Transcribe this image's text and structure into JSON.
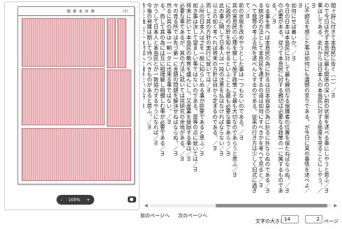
{
  "scan": {
    "header_title": "聞 新 本 日 寿",
    "page_number": "（7）"
  },
  "zoom": {
    "minus": "-",
    "value": "100%",
    "plus": "+"
  },
  "text": {
    "columns": [
      "聞ヶ辞に付きて本島民に告ぐ（一）／m",
      "ので今日は先ず本島民に最も関係の深い前の状景を述べる事にしやうと思ふ／m",
      "事はしてある。此れからは日本人の本島民に対する態度を見ることにしやう。／m",
      "に不調法を感じた事は如何にも遺憾の至りである。が今日に其の事情を述べよ／m",
      "如何にせば善いか。／m",
      "今日の日本は本島民に対して最も親切なる保護者の位置を保たねばならぬ。／m",
      "の必要がある。従つて本島民に対する親切は必要なる政策の一に属するものである。／m",
      "なる事を思へば本島民の為に計るは日本自身の為に計るに外ならぬのである／m",
      "る統治の方法として本島民を遇するの道は如何にすべきかを考へて見ると／m",
      "へて我等の考ふる所を述べんとするのである。従来の行き方は少しく旧式に過ぎて／m",
      "前の状態を改めやうとした事は一つもないのである。／m",
      "其の実島民の心理を察して施す政策こそ最も大切なのであらうと思ふ／m",
      "に政府の方針を知らせるといふことも最も必要な事であらう／m",
      "此の事に関して日本人は一段の注意を払はなければならない／m",
      "以上の如く考へれば将来の方針は自から定まるのである。／m",
      "而して其の方針の実行に就いては／m",
      "ふ所の日本人は之を一般に知らしめる事が肝要であると思ふ／m",
      "如き事は決して望ましい事ではないのである。是等の点に就いては／m",
      "将来に於いて本島民の教育を盛んにし、又産業を奨励する事は／m",
      "必要な事であるが、其の方法に就いては尚研究の余地がある。／m",
      "々の見る所では先づ第一に言語の問題を解決せねばならぬ。／m",
      "然るに其の事は一朝一夕に出来る事ではない。／m",
      "る。而して其の為には互に相理解し相親しむ事が必要である／m",
      "かうして日本人と本島民とが一致協力するやうになれば／m",
      "今後の発展は期して待つべきものがあると思ふ。／m",
      "終りに臨んで一言附加へて置きたいのは／m",
      "何事も急がず徐々に進むべきであるといふことである。／m",
      "尚此の問題に就いては次号に於いて述べる事にする。／m"
    ]
  },
  "nav": {
    "prev": "前のページへ",
    "next": "次のページへ"
  },
  "controls": {
    "fontsize_label": "文字の大きさ",
    "fontsize_value": "14",
    "page_value": "2",
    "page_label": "ページ"
  }
}
